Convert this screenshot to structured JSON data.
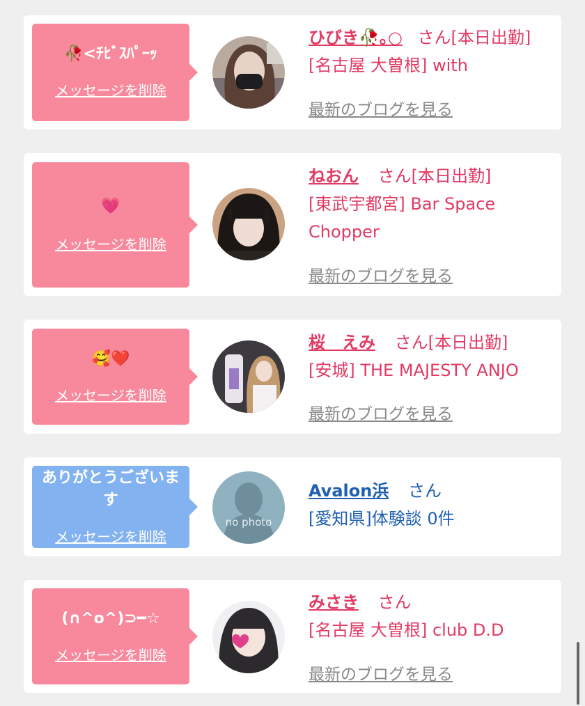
{
  "colors": {
    "pink_bubble": "#f8899c",
    "blue_bubble": "#82b2f0",
    "shop_red": "#e23a63",
    "shop_blue": "#1f5fb0",
    "blog_gray": "#888888"
  },
  "delete_label": "メッセージを削除",
  "blog_label": "最新のブログを見る",
  "cards": [
    {
      "message": "🥀<ﾁﾋﾞｽﾊﾟｰｯ",
      "name": "ひびき🥀｡○",
      "san": "さん",
      "status": "[本日出勤]",
      "shop": "[名古屋 大曽根] with",
      "shop2": "",
      "has_blog": true
    },
    {
      "message": "💗",
      "name": "ねおん",
      "san": "さん",
      "status": "[本日出勤]",
      "shop": "[東武宇都宮] Bar Space",
      "shop2": "Chopper",
      "has_blog": true
    },
    {
      "message": "🥰❤️",
      "name": "桜　えみ",
      "san": "さん",
      "status": "[本日出勤]",
      "shop": "[安城] THE MAJESTY ANJO",
      "shop2": "",
      "has_blog": true
    },
    {
      "message": "ありがとうございます",
      "name": "Avalon浜",
      "san": "さん",
      "status": "",
      "shop": "[愛知県]体験談 0件",
      "shop2": "",
      "avatar_text": "no photo",
      "has_blog": false
    },
    {
      "message": "(∩^o^)⊃━☆",
      "name": "みさき",
      "san": "さん",
      "status": "",
      "shop": "[名古屋 大曽根] club D.D",
      "shop2": "",
      "has_blog": true
    }
  ]
}
